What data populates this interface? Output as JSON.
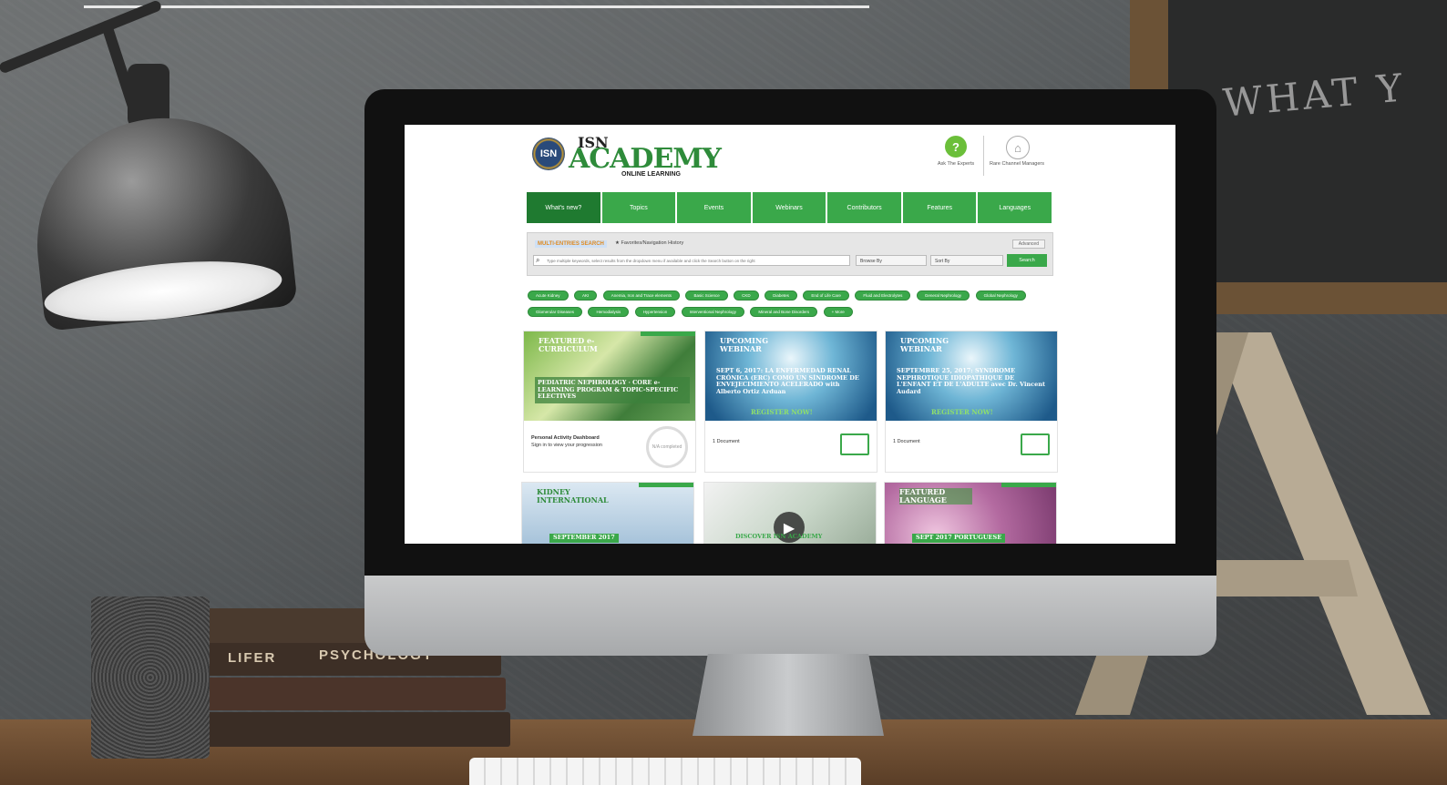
{
  "chalkboard": {
    "text": "WHAT Y"
  },
  "books": {
    "spine_1": "LIFER",
    "spine_2": "PSYCHOLOGY"
  },
  "site": {
    "logo_badge": "ISN",
    "logo_top": "ISN",
    "logo_main": "ACADEMY",
    "logo_sub": "ONLINE LEARNING",
    "header_links": [
      {
        "icon": "question-icon",
        "label": "Ask The Experts"
      },
      {
        "icon": "tower-icon",
        "label": "Rare Channel Managers"
      }
    ],
    "nav": [
      "What's new?",
      "Topics",
      "Events",
      "Webinars",
      "Contributors",
      "Features",
      "Languages"
    ],
    "search": {
      "brand": "MULTI-ENTRIES SEARCH",
      "favorites": "★ Favorites/Navigation History",
      "advanced": "Advanced",
      "placeholder": "Type multiple keywords, select results from the dropdown menu if available and click the Search button on the right",
      "browse": "Browse By",
      "sort": "Sort By",
      "button": "Search"
    },
    "tags": [
      "Acute Kidney",
      "AKI",
      "Anemia, Iron and Trace elements",
      "Basic Science",
      "CKD",
      "Diabetes",
      "End of Life Care",
      "Fluid and Electrolytes",
      "General Nephrology",
      "Global Nephrology",
      "Glomerular Diseases",
      "Hemodialysis",
      "Hypertension",
      "Interventional Nephrology",
      "Mineral and Bone Disorders",
      "+ More"
    ],
    "cards": [
      {
        "kicker": "FEATURED e-CURRICULUM",
        "headline": "PEDIATRIC NEPHROLOGY · CORE e-LEARNING PROGRAM & TOPIC-SPECIFIC ELECTIVES",
        "foot": "Personal Activity Dashboard",
        "foot_sub": "Sign in to view your progression",
        "ring": "N/A completed"
      },
      {
        "kicker": "UPCOMING WEBINAR",
        "headline": "SEPT 6, 2017: LA ENFERMEDAD RENAL CRÓNICA (ERC) COMO UN SÍNDROME DE ENVEJECIMIENTO ACELERADO with Alberto Ortiz Arduan",
        "register": "REGISTER NOW!",
        "foot": "1 Document"
      },
      {
        "kicker": "UPCOMING WEBINAR",
        "headline": "SEPTEMBRE 25, 2017: SYNDROME NEPHROTIQUE IDIOPATHIQUE DE L'ENFANT ET DE L'ADULTE avec Dr. Vincent Audard",
        "register": "REGISTER NOW!",
        "foot": "1 Document"
      },
      {
        "kicker": "KIDNEY INTERNATIONAL",
        "headline": "SEPTEMBER 2017"
      },
      {
        "kicker": "",
        "headline": "DISCOVER ISN ACADEMY"
      },
      {
        "kicker": "FEATURED LANGUAGE",
        "headline": "SEPT 2017 PORTUGUESE"
      }
    ]
  }
}
